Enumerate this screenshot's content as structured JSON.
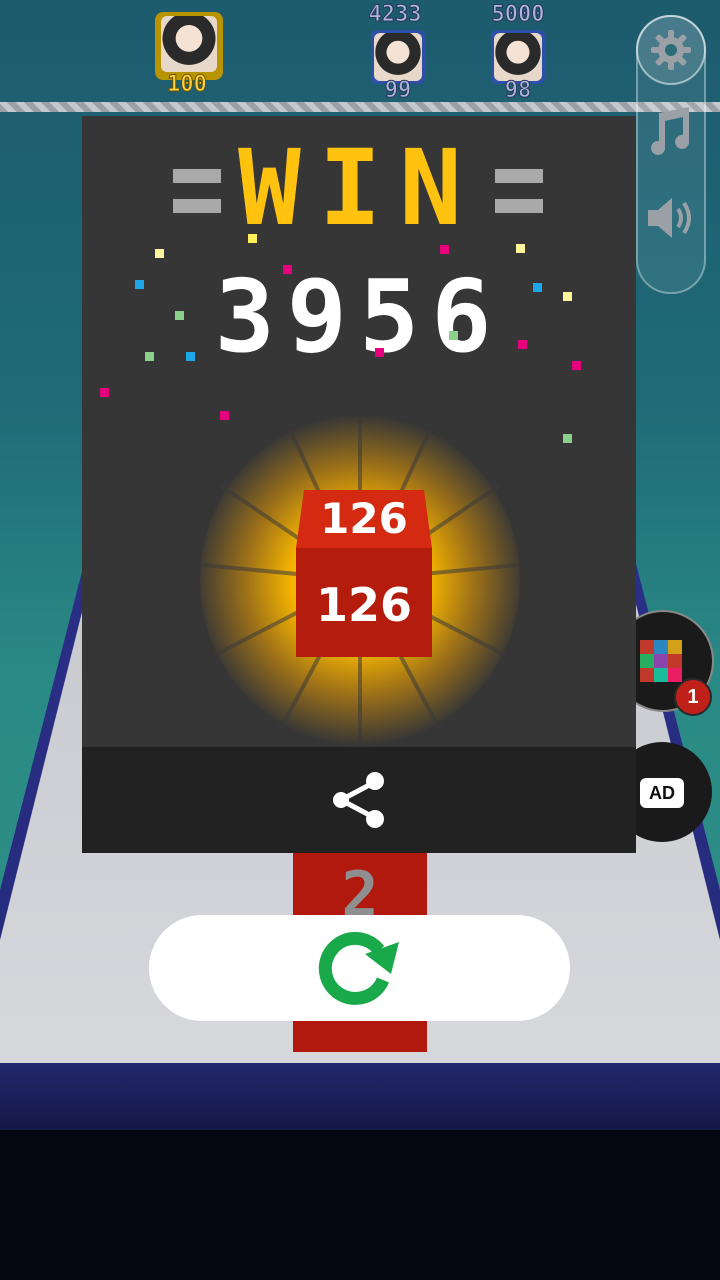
{
  "leaderboard": {
    "players": [
      {
        "rank_score": "",
        "score": "100",
        "highlight": "#b89400"
      },
      {
        "rank_score": "4233",
        "score": "99",
        "highlight": "#2e4fa8"
      },
      {
        "rank_score": "5000",
        "score": "98",
        "highlight": "#2e4fa8"
      }
    ]
  },
  "win_dialog": {
    "title": "WIN",
    "score": "3956",
    "cube_value": "126",
    "colors": {
      "title": "#ffc20e",
      "cube": "#b41c0e",
      "panel": "#363636"
    }
  },
  "track": {
    "tile_number": "2"
  },
  "side_controls": {
    "icons": [
      "gear-icon",
      "music-icon",
      "speaker-icon",
      "cube-icon",
      "ad-video-icon"
    ],
    "powerup_count": "1",
    "ad_label": "AD"
  },
  "actions": {
    "icons": [
      "share-icon",
      "restart-icon"
    ],
    "restart_color": "#19a84a"
  }
}
